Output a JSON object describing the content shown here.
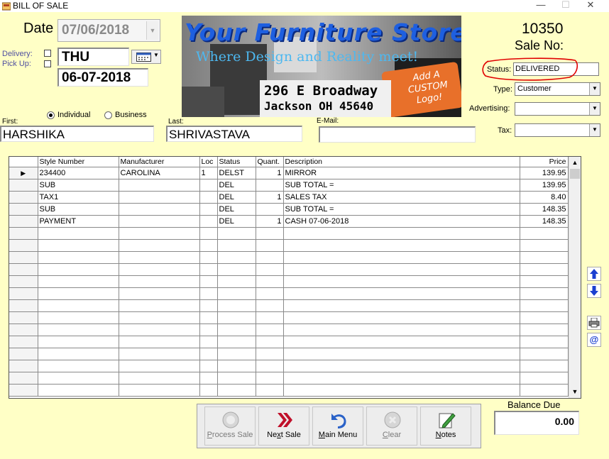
{
  "window": {
    "title": "BILL OF SALE",
    "min": "—",
    "max": "☐",
    "close": "✕"
  },
  "header": {
    "date_label": "Date",
    "date_value": "07/06/2018",
    "delivery_label": "Delivery:",
    "pickup_label": "Pick Up:",
    "day_value": "THU",
    "delivery_date": "06-07-2018",
    "sale_no": "10350",
    "sale_no_label": "Sale No:"
  },
  "banner": {
    "line1": "Your Furniture Store",
    "line2": "Where Design and Reality meet!",
    "addr1": "296 E Broadway",
    "addr2": "Jackson OH 45640",
    "badge1": "Add A",
    "badge2": "CUSTOM",
    "badge3": "Logo!"
  },
  "customer": {
    "individual_label": "Individual",
    "business_label": "Business",
    "first_label": "First:",
    "first_value": "HARSHIKA",
    "last_label": "Last:",
    "last_value": "SHRIVASTAVA",
    "email_label": "E-Mail:",
    "email_value": ""
  },
  "fields": {
    "status_label": "Status:",
    "status_value": "DELIVERED",
    "type_label": "Type:",
    "type_value": "Customer",
    "advertising_label": "Advertising:",
    "advertising_value": "",
    "tax_label": "Tax:",
    "tax_value": ""
  },
  "grid": {
    "columns": [
      "Style Number",
      "Manufacturer",
      "Loc",
      "Status",
      "Quant.",
      "Description",
      "Price"
    ],
    "rows": [
      [
        "234400",
        "CAROLINA",
        "1",
        "DELST",
        "1",
        "MIRROR",
        "139.95"
      ],
      [
        "SUB",
        "",
        "",
        "DEL",
        "",
        "SUB TOTAL =",
        "139.95"
      ],
      [
        "TAX1",
        "",
        "",
        "DEL",
        "1",
        "SALES TAX",
        "8.40"
      ],
      [
        "SUB",
        "",
        "",
        "DEL",
        "",
        "SUB TOTAL =",
        "148.35"
      ],
      [
        "PAYMENT",
        "",
        "",
        "DEL",
        "1",
        "CASH 07-06-2018",
        "148.35"
      ]
    ]
  },
  "toolbar": {
    "process_sale": "Process Sale",
    "next_sale": "Next Sale",
    "main_menu": "Main Menu",
    "clear": "Clear",
    "notes": "Notes"
  },
  "balance": {
    "label": "Balance Due",
    "value": "0.00"
  },
  "colors": {
    "background": "#FFFFC6",
    "annotation_red": "#E00000",
    "arrow_blue": "#1A3FD0"
  }
}
